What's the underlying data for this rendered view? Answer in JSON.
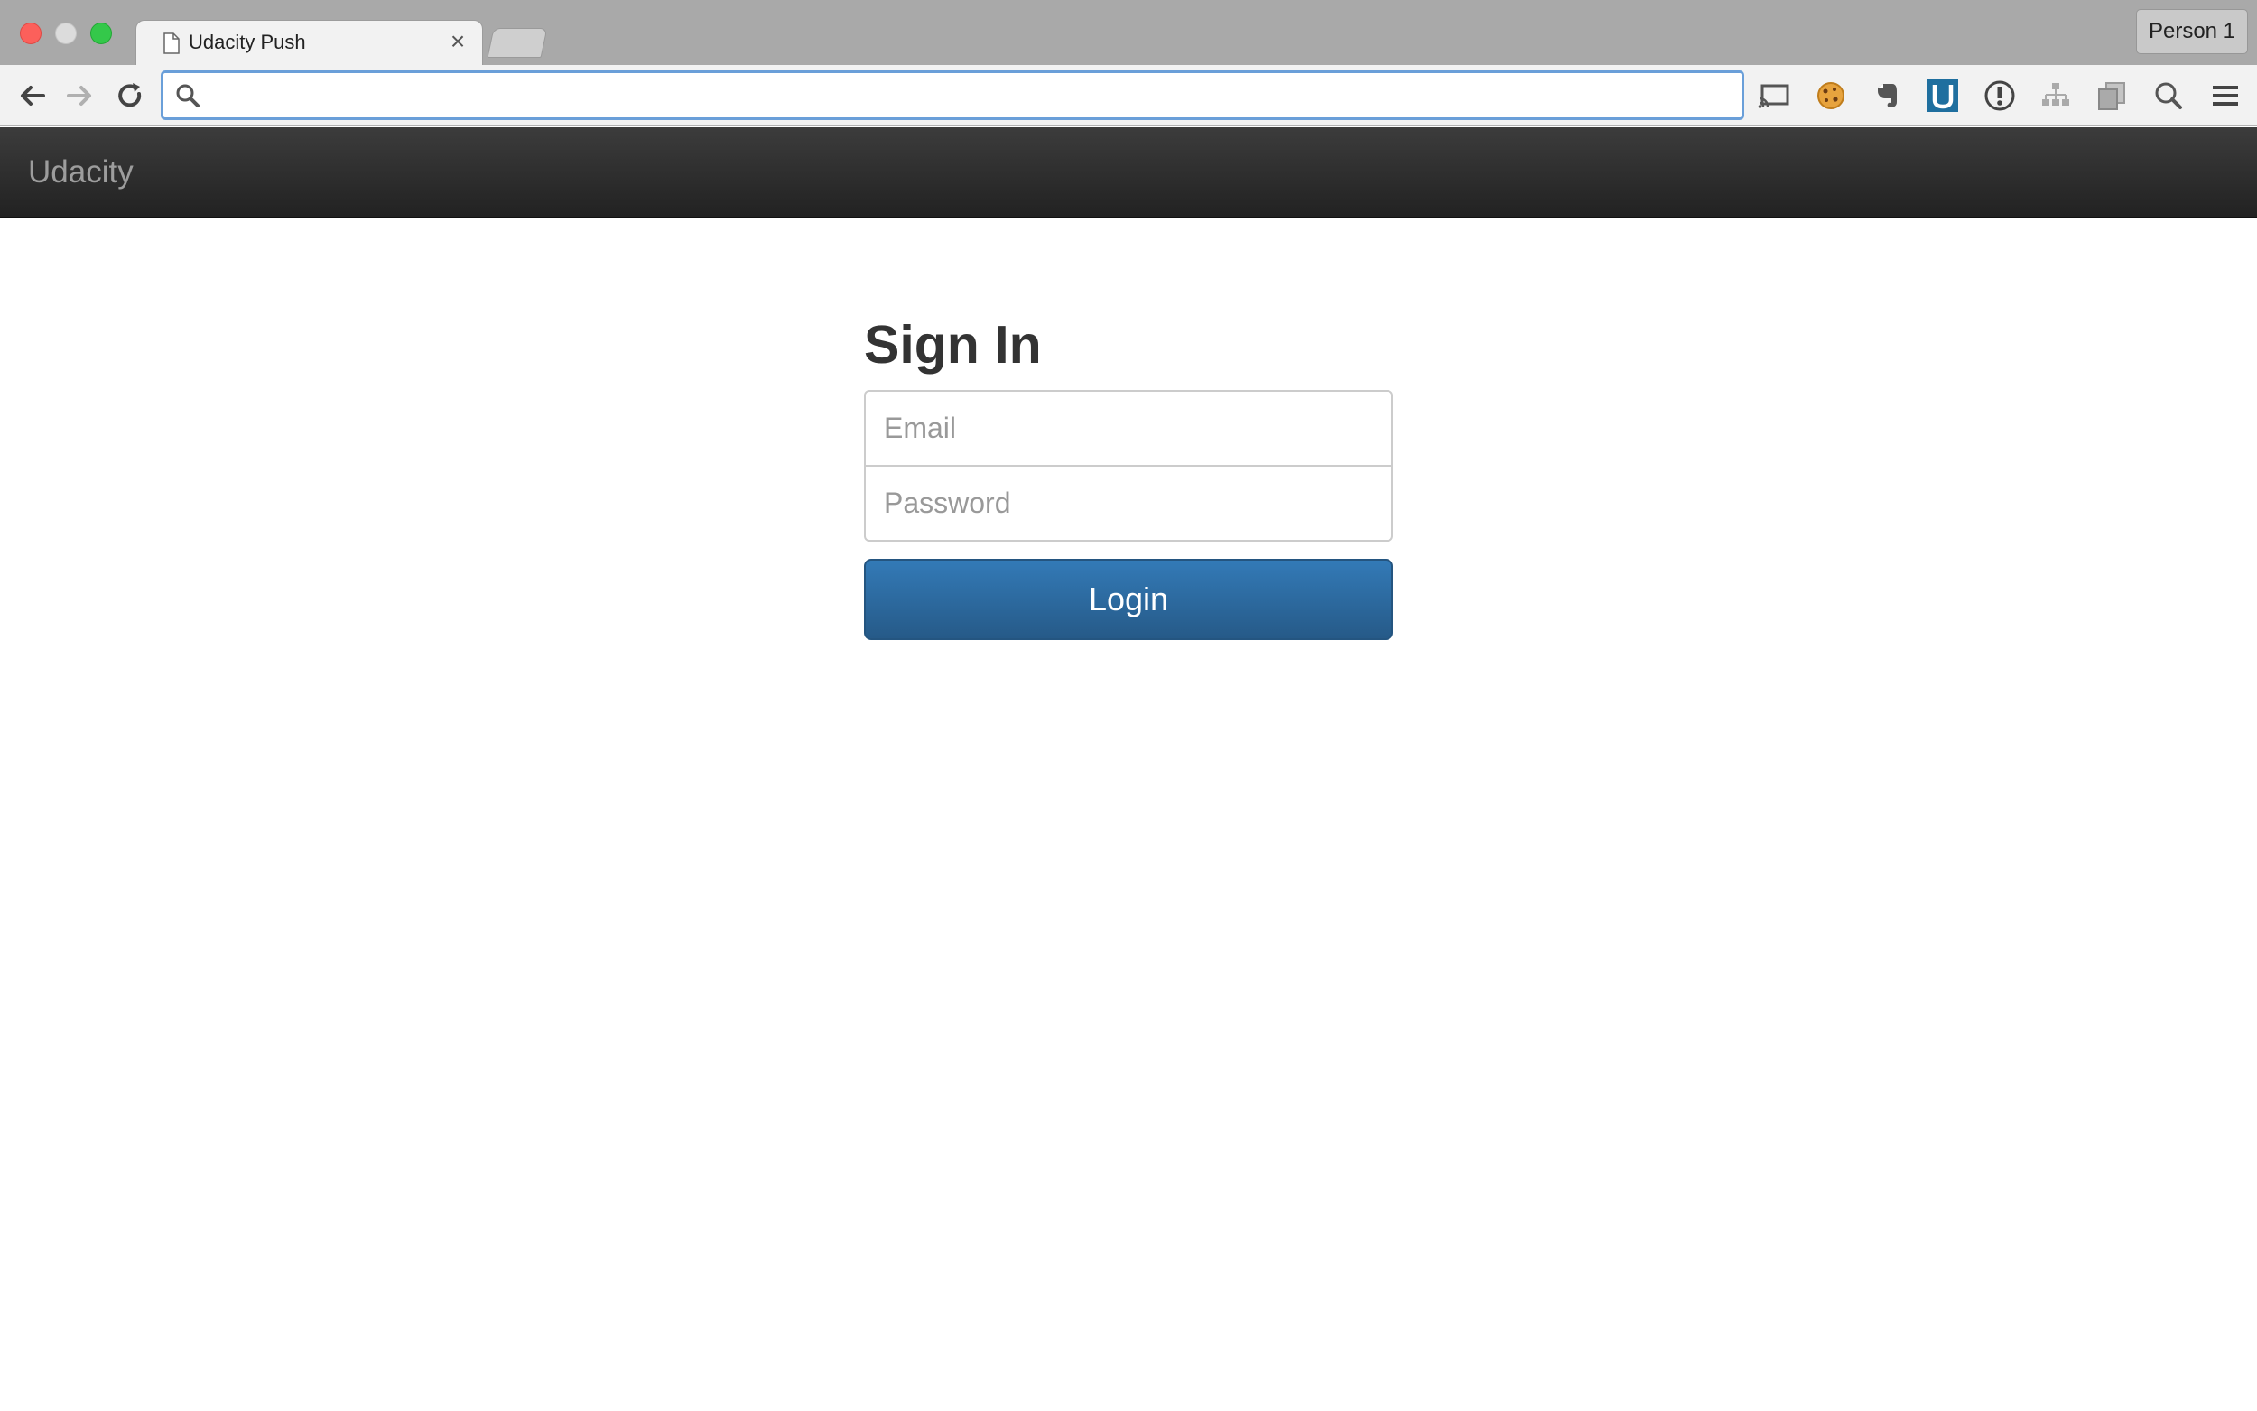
{
  "browser": {
    "tab_title": "Udacity Push",
    "tab_close": "×",
    "profile_label": "Person 1",
    "address_value": "",
    "extensions": [
      "cast-icon",
      "cookie-icon",
      "evernote-icon",
      "udacity-u-icon",
      "info-circle-icon",
      "sitemap-icon",
      "copy-icon",
      "magnifier-icon",
      "menu-icon"
    ]
  },
  "navbar": {
    "brand": "Udacity"
  },
  "signin": {
    "heading": "Sign In",
    "email_placeholder": "Email",
    "email_value": "",
    "password_placeholder": "Password",
    "password_value": "",
    "login_label": "Login"
  },
  "colors": {
    "primary_button": "#337ab7",
    "navbar_bg": "#222222",
    "omnibox_focus": "#6a9fd9"
  }
}
